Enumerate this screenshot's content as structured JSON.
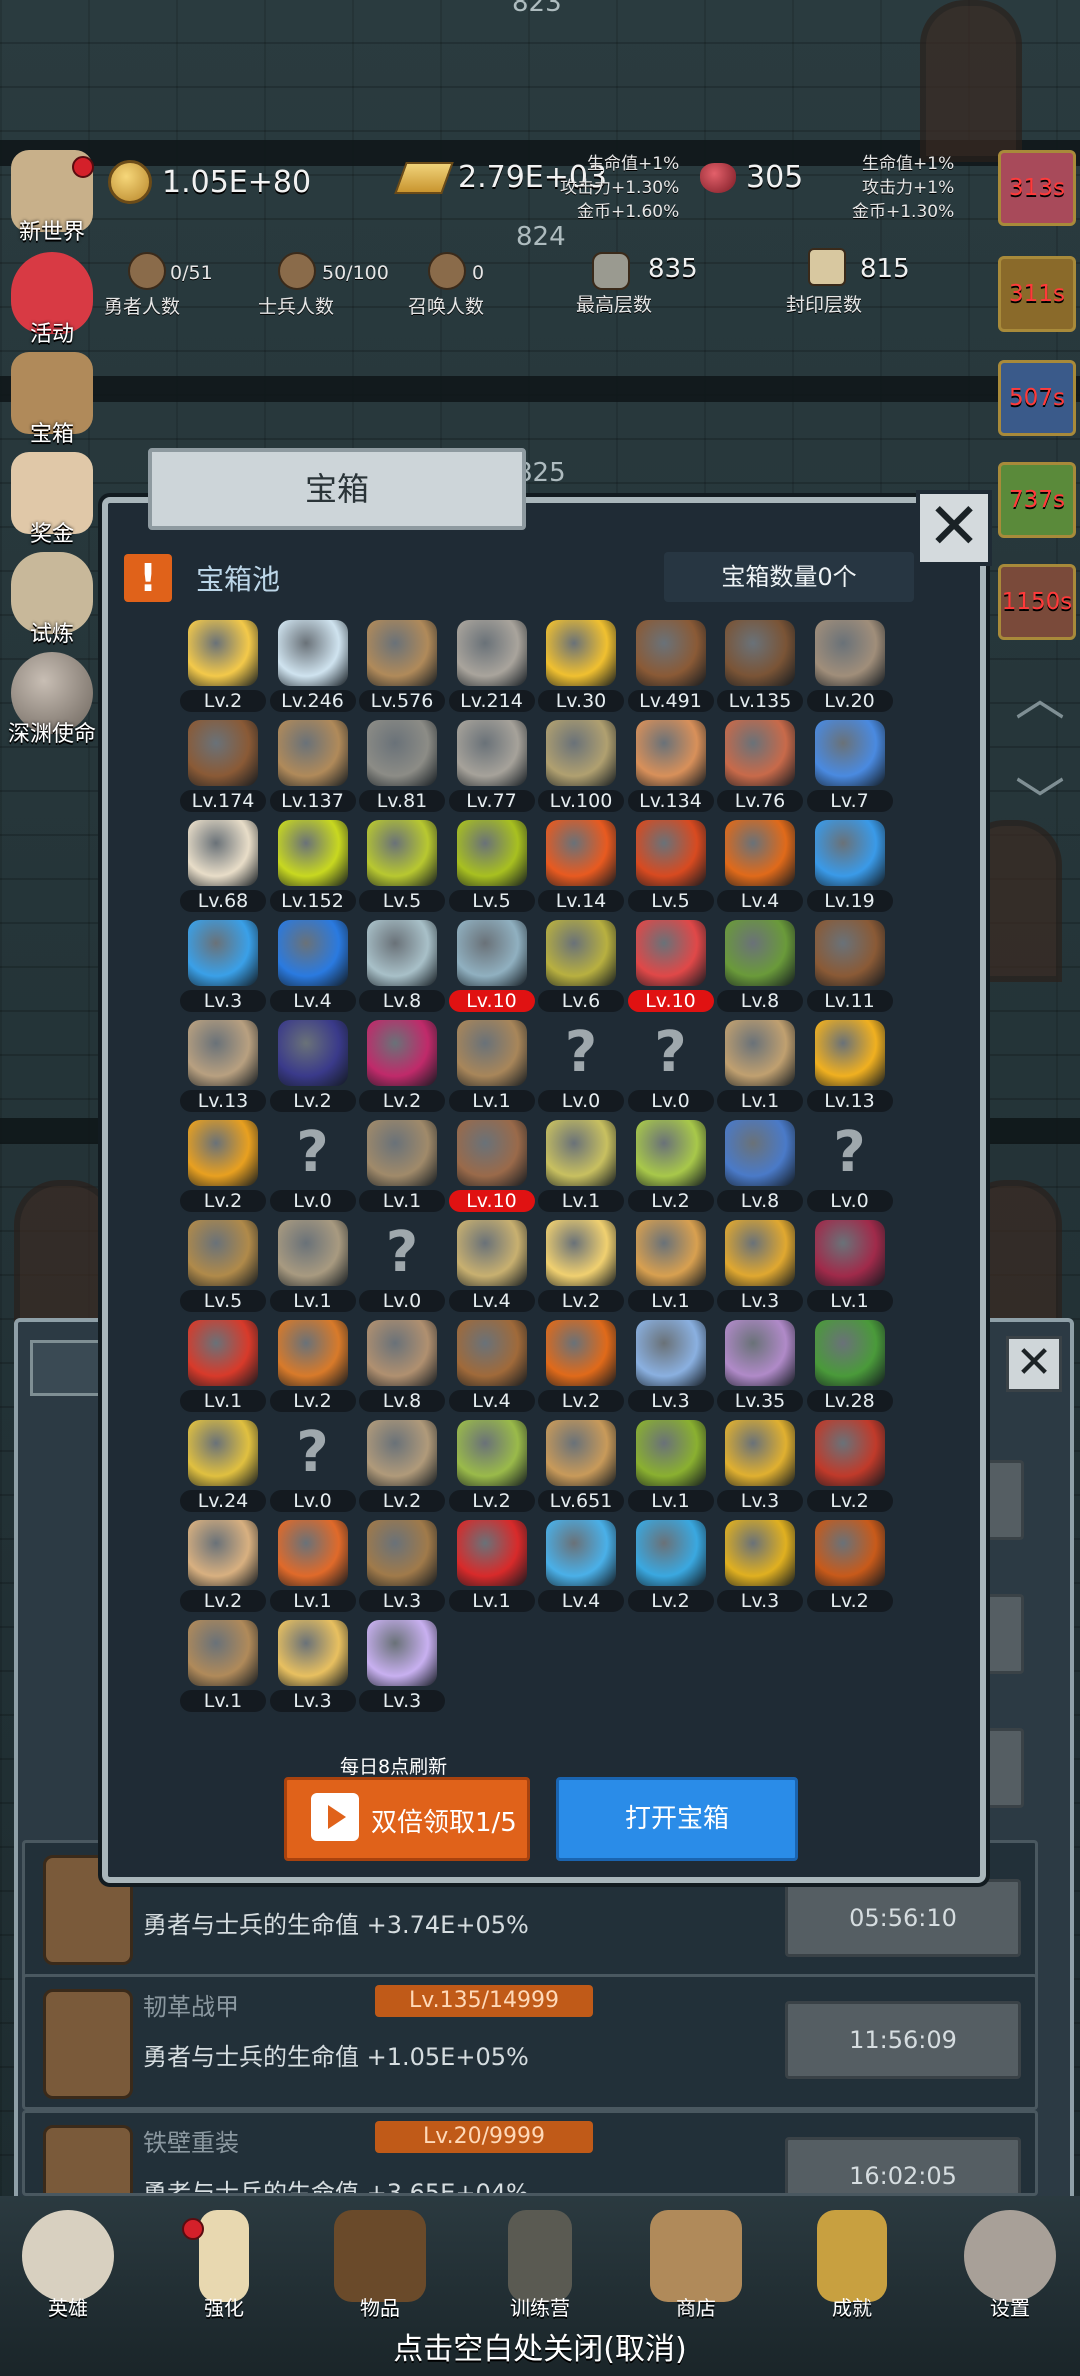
{
  "hud": {
    "gold_coin": "1.05E+80",
    "gold_bar": "2.79E+03",
    "gem": "305",
    "floor_top": "823",
    "floor_mid": "824",
    "floor_low": "825",
    "buff_left": [
      "生命值+1%",
      "攻击力+1.30%",
      "金币+1.60%"
    ],
    "buff_right": [
      "生命值+1%",
      "攻击力+1%",
      "金币+1.30%"
    ],
    "heroes": {
      "value": "0/51",
      "label": "勇者人数"
    },
    "soldiers": {
      "value": "50/100",
      "label": "士兵人数"
    },
    "summons": {
      "value": "0",
      "label": "召唤人数"
    },
    "max_floor": {
      "value": "835",
      "label": "最高层数"
    },
    "seal_floor": {
      "value": "815",
      "label": "封印层数"
    }
  },
  "side_menu": [
    "新世界",
    "活动",
    "宝箱",
    "奖金",
    "试炼",
    "深渊使命"
  ],
  "timers": [
    "313s",
    "311s",
    "507s",
    "737s",
    "1150s"
  ],
  "dialog": {
    "title": "宝箱",
    "pool_label": "宝箱池",
    "count_text": "宝箱数量0个",
    "refresh_note": "每日8点刷新",
    "double_btn": "双倍领取1/5",
    "open_btn": "打开宝箱",
    "items": [
      {
        "icon": "crown-icon",
        "lv": "Lv.2",
        "color": "#f3c94a"
      },
      {
        "icon": "diamond-icon",
        "lv": "Lv.246",
        "color": "#cfe3ef"
      },
      {
        "icon": "sword-icon",
        "lv": "Lv.576",
        "color": "#b08a5a"
      },
      {
        "icon": "sword-icon",
        "lv": "Lv.214",
        "color": "#a9a49c"
      },
      {
        "icon": "gold-sword-icon",
        "lv": "Lv.30",
        "color": "#f0c030"
      },
      {
        "icon": "armor-icon",
        "lv": "Lv.491",
        "color": "#8a5a36"
      },
      {
        "icon": "armor-icon",
        "lv": "Lv.135",
        "color": "#7a5436"
      },
      {
        "icon": "armor-icon",
        "lv": "Lv.20",
        "color": "#a08e7a"
      },
      {
        "icon": "helmet-icon",
        "lv": "Lv.174",
        "color": "#8a5a36"
      },
      {
        "icon": "dagger-icon",
        "lv": "Lv.137",
        "color": "#b08a5a"
      },
      {
        "icon": "helmet-icon",
        "lv": "Lv.81",
        "color": "#8c8c86"
      },
      {
        "icon": "hammer-icon",
        "lv": "Lv.77",
        "color": "#a6a29a"
      },
      {
        "icon": "helmet-icon",
        "lv": "Lv.100",
        "color": "#b0a070"
      },
      {
        "icon": "meat-icon",
        "lv": "Lv.134",
        "color": "#d8905a"
      },
      {
        "icon": "meat-icon",
        "lv": "Lv.76",
        "color": "#c86a4a"
      },
      {
        "icon": "bag-icon",
        "lv": "Lv.7",
        "color": "#4a8ae0"
      },
      {
        "icon": "bowl-icon",
        "lv": "Lv.68",
        "color": "#e8ddc8"
      },
      {
        "icon": "potion-icon",
        "lv": "Lv.152",
        "color": "#c8d820"
      },
      {
        "icon": "potion-icon",
        "lv": "Lv.5",
        "color": "#b8c830"
      },
      {
        "icon": "potion-icon",
        "lv": "Lv.5",
        "color": "#a8c020"
      },
      {
        "icon": "potion-icon",
        "lv": "Lv.14",
        "color": "#e85a20"
      },
      {
        "icon": "potion-icon",
        "lv": "Lv.5",
        "color": "#d84a20"
      },
      {
        "icon": "potion-icon",
        "lv": "Lv.4",
        "color": "#e06a1a"
      },
      {
        "icon": "potion-icon",
        "lv": "Lv.19",
        "color": "#3a9ae8"
      },
      {
        "icon": "potion-icon",
        "lv": "Lv.3",
        "color": "#3aa0e8"
      },
      {
        "icon": "potion-icon",
        "lv": "Lv.4",
        "color": "#2a7ae0"
      },
      {
        "icon": "potion-icon",
        "lv": "Lv.8",
        "color": "#a8c0c8"
      },
      {
        "icon": "potion-icon",
        "lv": "Lv.10",
        "color": "#90b0c0",
        "hot": true
      },
      {
        "icon": "potion-icon",
        "lv": "Lv.6",
        "color": "#b8b040"
      },
      {
        "icon": "potion-icon",
        "lv": "Lv.10",
        "color": "#e04848",
        "hot": true
      },
      {
        "icon": "winged-boot-icon",
        "lv": "Lv.8",
        "color": "#6a9a3a"
      },
      {
        "icon": "boot-icon",
        "lv": "Lv.11",
        "color": "#8a5a36"
      },
      {
        "icon": "boot-icon",
        "lv": "Lv.13",
        "color": "#b8a080"
      },
      {
        "icon": "boot-icon",
        "lv": "Lv.2",
        "color": "#3a3a8a"
      },
      {
        "icon": "boot-icon",
        "lv": "Lv.2",
        "color": "#c02a6a"
      },
      {
        "icon": "shield-icon",
        "lv": "Lv.1",
        "color": "#a8865a"
      },
      {
        "icon": "unknown-icon",
        "lv": "Lv.0",
        "q": true
      },
      {
        "icon": "unknown-icon",
        "lv": "Lv.0",
        "q": true
      },
      {
        "icon": "knife-icon",
        "lv": "Lv.1",
        "color": "#c0a070"
      },
      {
        "icon": "torch-icon",
        "lv": "Lv.13",
        "color": "#f0b020"
      },
      {
        "icon": "torch-icon",
        "lv": "Lv.2",
        "color": "#e8a020"
      },
      {
        "icon": "unknown-icon",
        "lv": "Lv.0",
        "q": true
      },
      {
        "icon": "pickaxe-icon",
        "lv": "Lv.1",
        "color": "#a08a6a"
      },
      {
        "icon": "staff-icon",
        "lv": "Lv.10",
        "color": "#9a6a4a",
        "hot": true
      },
      {
        "icon": "fruit-icon",
        "lv": "Lv.1",
        "color": "#c8c060"
      },
      {
        "icon": "fruit-icon",
        "lv": "Lv.2",
        "color": "#a8c84a"
      },
      {
        "icon": "wand-icon",
        "lv": "Lv.8",
        "color": "#4a7ac8"
      },
      {
        "icon": "unknown-icon",
        "lv": "Lv.0",
        "q": true
      },
      {
        "icon": "backpack-icon",
        "lv": "Lv.5",
        "color": "#b08a4a"
      },
      {
        "icon": "shovel-icon",
        "lv": "Lv.1",
        "color": "#a89a80"
      },
      {
        "icon": "unknown-icon",
        "lv": "Lv.0",
        "q": true
      },
      {
        "icon": "broom-icon",
        "lv": "Lv.4",
        "color": "#c8b070"
      },
      {
        "icon": "cheese-icon",
        "lv": "Lv.2",
        "color": "#f0d070"
      },
      {
        "icon": "pie-icon",
        "lv": "Lv.1",
        "color": "#d8a050"
      },
      {
        "icon": "jar-icon",
        "lv": "Lv.3",
        "color": "#e0a830"
      },
      {
        "icon": "crystal-icon",
        "lv": "Lv.1",
        "color": "#a02a4a"
      },
      {
        "icon": "orb-icon",
        "lv": "Lv.1",
        "color": "#d83a2a"
      },
      {
        "icon": "gem-box-icon",
        "lv": "Lv.2",
        "color": "#d87a2a"
      },
      {
        "icon": "bow-icon",
        "lv": "Lv.8",
        "color": "#b09070"
      },
      {
        "icon": "quiver-icon",
        "lv": "Lv.4",
        "color": "#a06a3a"
      },
      {
        "icon": "glove-icon",
        "lv": "Lv.2",
        "color": "#e06a1a"
      },
      {
        "icon": "heart-gem-icon",
        "lv": "Lv.3",
        "color": "#8ab0e0"
      },
      {
        "icon": "cloud-icon",
        "lv": "Lv.35",
        "color": "#b08ac8"
      },
      {
        "icon": "badge-icon",
        "lv": "Lv.28",
        "color": "#4a9a3a"
      },
      {
        "icon": "scroll-icon",
        "lv": "Lv.24",
        "color": "#e0c040"
      },
      {
        "icon": "unknown-icon",
        "lv": "Lv.0",
        "q": true
      },
      {
        "icon": "arrow-icon",
        "lv": "Lv.2",
        "color": "#b09a7a"
      },
      {
        "icon": "mace-icon",
        "lv": "Lv.2",
        "color": "#9aba4a"
      },
      {
        "icon": "mug-icon",
        "lv": "Lv.651",
        "color": "#c89a5a"
      },
      {
        "icon": "vine-icon",
        "lv": "Lv.1",
        "color": "#8ab030"
      },
      {
        "icon": "gold-pickaxe-icon",
        "lv": "Lv.3",
        "color": "#e0b030"
      },
      {
        "icon": "book-icon",
        "lv": "Lv.2",
        "color": "#c03a2a"
      },
      {
        "icon": "scroll-icon",
        "lv": "Lv.2",
        "color": "#d8b080"
      },
      {
        "icon": "quill-icon",
        "lv": "Lv.1",
        "color": "#e06a2a"
      },
      {
        "icon": "whip-icon",
        "lv": "Lv.3",
        "color": "#a07a4a"
      },
      {
        "icon": "card-icon",
        "lv": "Lv.1",
        "color": "#d82a2a"
      },
      {
        "icon": "crystal-ball-icon",
        "lv": "Lv.4",
        "color": "#4ab0e8"
      },
      {
        "icon": "rune-icon",
        "lv": "Lv.2",
        "color": "#3aa8e0"
      },
      {
        "icon": "golden-orb-icon",
        "lv": "Lv.3",
        "color": "#e0b020"
      },
      {
        "icon": "torch-icon",
        "lv": "Lv.2",
        "color": "#c85a1a"
      },
      {
        "icon": "idol-icon",
        "lv": "Lv.1",
        "color": "#b08a5a"
      },
      {
        "icon": "rainbow-orb-icon",
        "lv": "Lv.3",
        "color": "#e8c060"
      },
      {
        "icon": "gem-icon",
        "lv": "Lv.3",
        "color": "#c8b0f0"
      }
    ]
  },
  "under_list": [
    {
      "name": "",
      "lvl": "",
      "desc": "勇者与士兵的生命值 +3.74E+05%",
      "time": "05:56:10"
    },
    {
      "name": "韧革战甲",
      "lvl": "Lv.135/14999",
      "desc": "勇者与士兵的生命值 +1.05E+05%",
      "time": "11:56:09"
    },
    {
      "name": "铁壁重装",
      "lvl": "Lv.20/9999",
      "desc": "勇者与士兵的生命值 +3.65E+04%",
      "time": "16:02:05"
    }
  ],
  "nav": [
    "英雄",
    "强化",
    "物品",
    "训练营",
    "商店",
    "成就",
    "设置"
  ],
  "close_hint": "点击空白处关闭(取消)"
}
